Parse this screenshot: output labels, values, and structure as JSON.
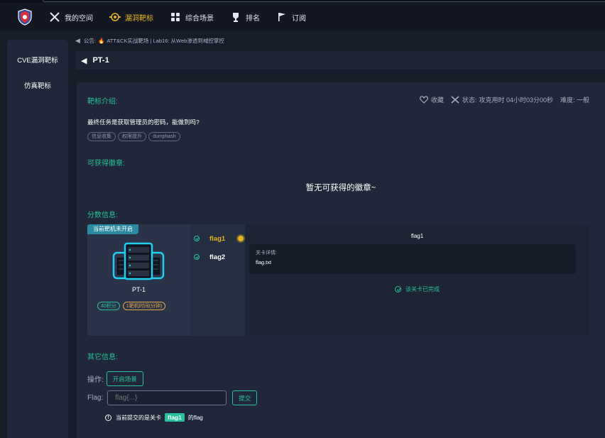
{
  "nav": {
    "items": [
      {
        "label": "我的空间",
        "icon": "swords-icon"
      },
      {
        "label": "漏洞靶标",
        "icon": "target-icon",
        "active": true
      },
      {
        "label": "综合场景",
        "icon": "grid-icon"
      },
      {
        "label": "排名",
        "icon": "trophy-icon"
      },
      {
        "label": "订阅",
        "icon": "flag-icon"
      }
    ]
  },
  "sidebar": {
    "items": [
      {
        "label": "CVE漏洞靶标"
      },
      {
        "label": "仿真靶标"
      }
    ]
  },
  "notice": {
    "prefix": "公告:",
    "text": "ATT&CK实战靶场 | Lab16: 从Web渗透到域控掌控"
  },
  "page": {
    "back": "◀",
    "title": "PT-1"
  },
  "intro": {
    "heading": "靶标介绍:",
    "favorite": "收藏",
    "status_label": "状态:",
    "status_value": "攻克用时 04小时03分00秒",
    "difficulty": "难度: 一般",
    "description": "最终任务是获取管理员的密码，能做到吗?",
    "tags": [
      "信息收集",
      "权限提升",
      "dumphash"
    ]
  },
  "badges": {
    "heading": "可获得徽章:",
    "empty": "暂无可获得的徽章~"
  },
  "score": {
    "heading": "分数信息:",
    "machine_status": "当前靶机未开启",
    "machine_name": "PT-1",
    "points": "40积分",
    "time": "1靶机时间(分钟)",
    "flags": [
      {
        "label": "flag1",
        "selected": true
      },
      {
        "label": "flag2",
        "selected": false
      }
    ],
    "detail_title": "flag1",
    "detail_key": "关卡详情:",
    "detail_value": "flag.txt",
    "completed": "该关卡已完成"
  },
  "other": {
    "heading": "其它信息:",
    "op_label": "操作:",
    "open_scene": "开启场景",
    "flag_label": "Flag:",
    "flag_placeholder": "flag{...}",
    "submit": "提交",
    "hint_pre": "当前提交的是关卡",
    "hint_flag": "flag1",
    "hint_post": "的flag"
  },
  "colors": {
    "accent": "#27c29b",
    "active": "#e6b21f",
    "panel": "#1f2738",
    "background": "#171c29"
  }
}
